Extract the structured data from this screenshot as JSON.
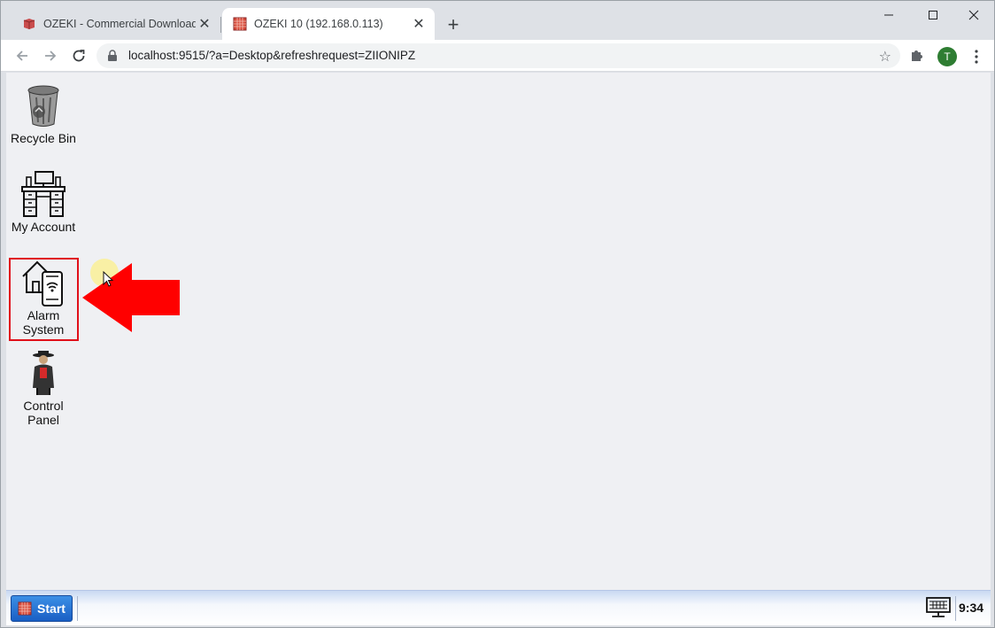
{
  "browser": {
    "tabs": [
      {
        "title": "OZEKI - Commercial Download",
        "favicon": "ozeki-box-icon",
        "active": false
      },
      {
        "title": "OZEKI 10 (192.168.0.113)",
        "favicon": "ozeki-grid-icon",
        "active": true
      }
    ],
    "url": "localhost:9515/?a=Desktop&refreshrequest=ZIIONIPZ",
    "profile_initial": "T"
  },
  "desktop": {
    "icons": [
      {
        "line1": "Recycle Bin",
        "line2": "",
        "icon": "recycle-bin-icon"
      },
      {
        "line1": "My Account",
        "line2": "",
        "icon": "desk-computer-icon"
      },
      {
        "line1": "Alarm",
        "line2": "System",
        "icon": "home-phone-wifi-icon",
        "highlighted": true
      },
      {
        "line1": "Control",
        "line2": "Panel",
        "icon": "agent-figure-icon"
      }
    ]
  },
  "taskbar": {
    "start_label": "Start",
    "clock": "9:34"
  },
  "colors": {
    "highlight": "#e0101a",
    "arrow": "#ff0000",
    "start_button": "#1a5fc4"
  }
}
